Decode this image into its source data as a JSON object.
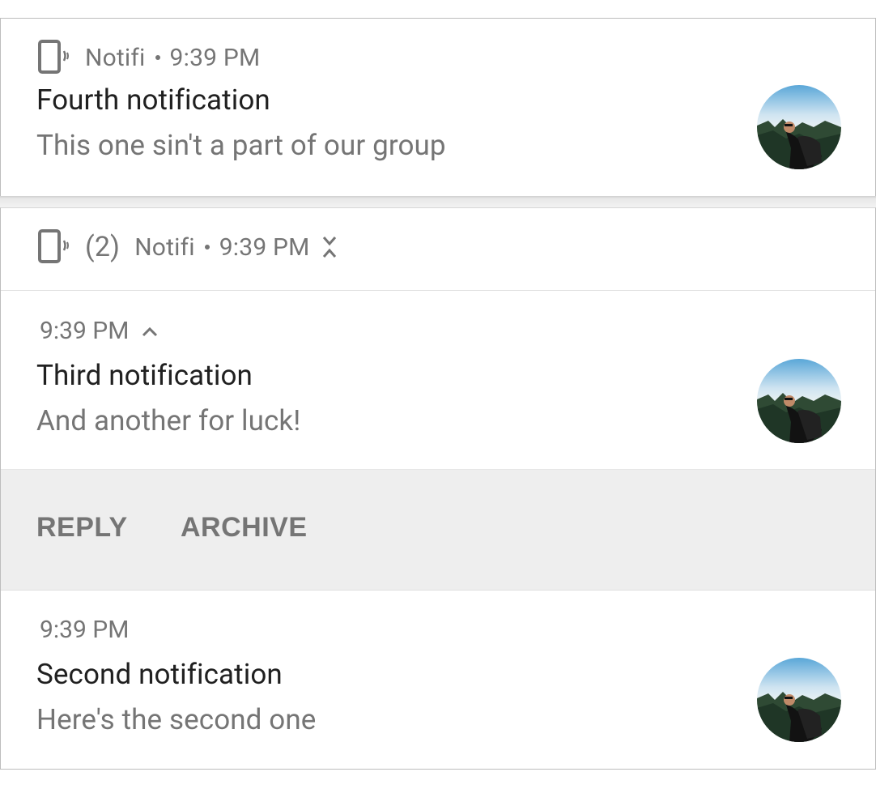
{
  "notifications": {
    "fourth": {
      "app_name": "Notifi",
      "time": "9:39 PM",
      "title": "Fourth notification",
      "text": "This one sin't a part of our group"
    },
    "group": {
      "count": "(2)",
      "app_name": "Notifi",
      "time": "9:39 PM",
      "items": [
        {
          "time": "9:39 PM",
          "title": "Third notification",
          "text": "And another for luck!",
          "actions": [
            "REPLY",
            "ARCHIVE"
          ]
        },
        {
          "time": "9:39 PM",
          "title": "Second notification",
          "text": "Here's the second one"
        }
      ]
    }
  },
  "icons": {
    "app": "phone-vibrate-icon",
    "collapse_group": "collapse-icon",
    "expand_toggle": "chevron-up-icon"
  },
  "colors": {
    "title": "#202020",
    "secondary": "#757575",
    "actions_bg": "#eeeeee",
    "border": "#bdbdbd"
  }
}
